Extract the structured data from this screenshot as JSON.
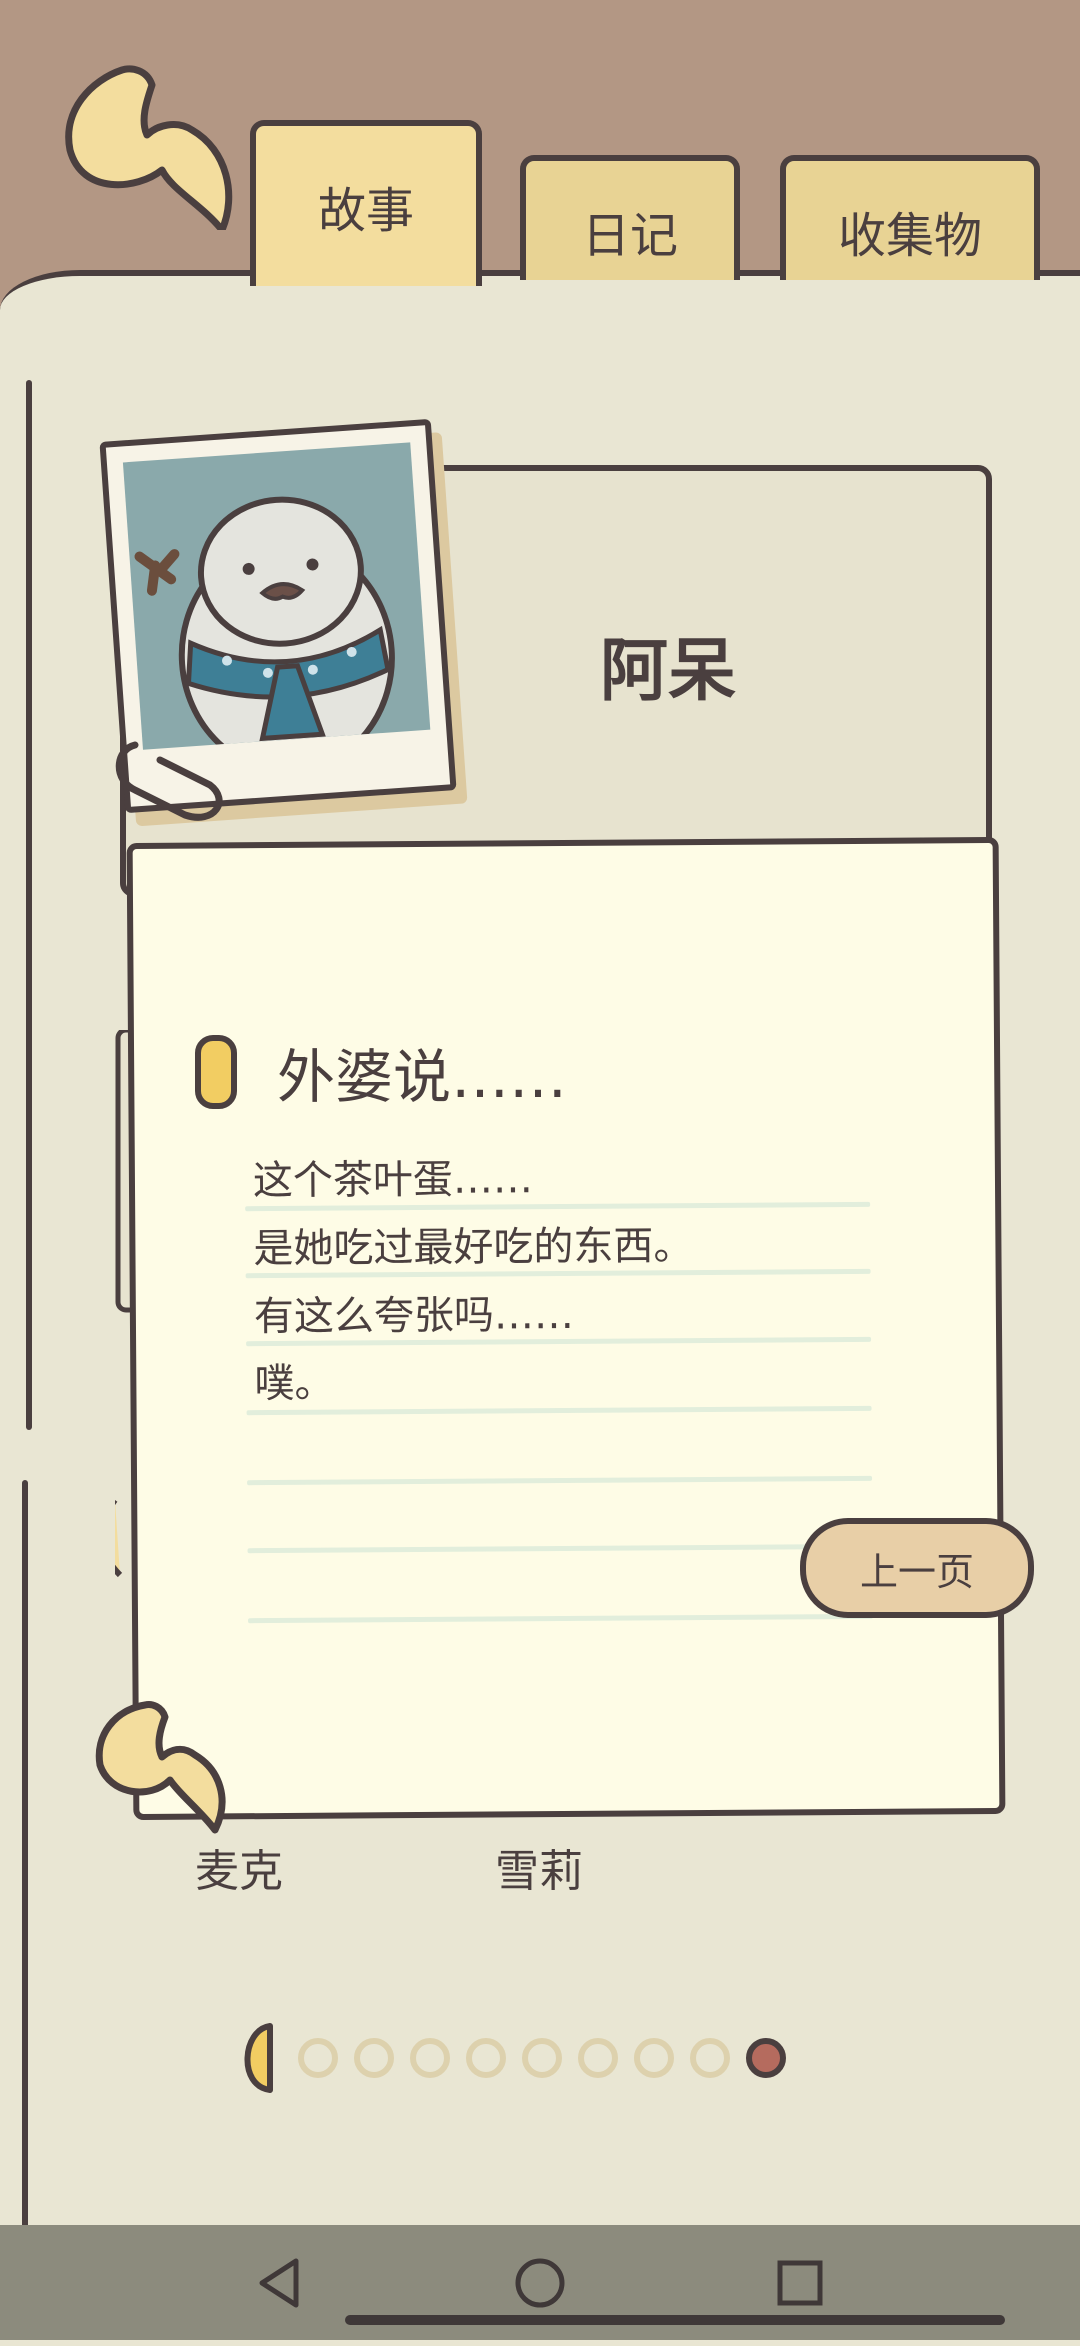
{
  "tabs": [
    {
      "label": "故事",
      "active": true
    },
    {
      "label": "日记",
      "active": false
    },
    {
      "label": "收集物",
      "active": false
    }
  ],
  "character": {
    "name": "阿呆"
  },
  "note": {
    "title": "外婆说……",
    "lines": [
      "这个茶叶蛋……",
      "是她吃过最好吃的东西。",
      "有这么夸张吗……",
      "噗。",
      "",
      "",
      ""
    ]
  },
  "prev_button": {
    "label": "上一页"
  },
  "friends": [
    {
      "name": "麦克"
    },
    {
      "name": "雪莉"
    }
  ],
  "pager": {
    "total": 9,
    "current": 9
  },
  "colors": {
    "background": "#b39784",
    "paper": "#e9e6d3",
    "note": "#fefce6",
    "tab": "#e8d394",
    "outline": "#4a3f3f",
    "accent_dot": "#b56b5e"
  }
}
